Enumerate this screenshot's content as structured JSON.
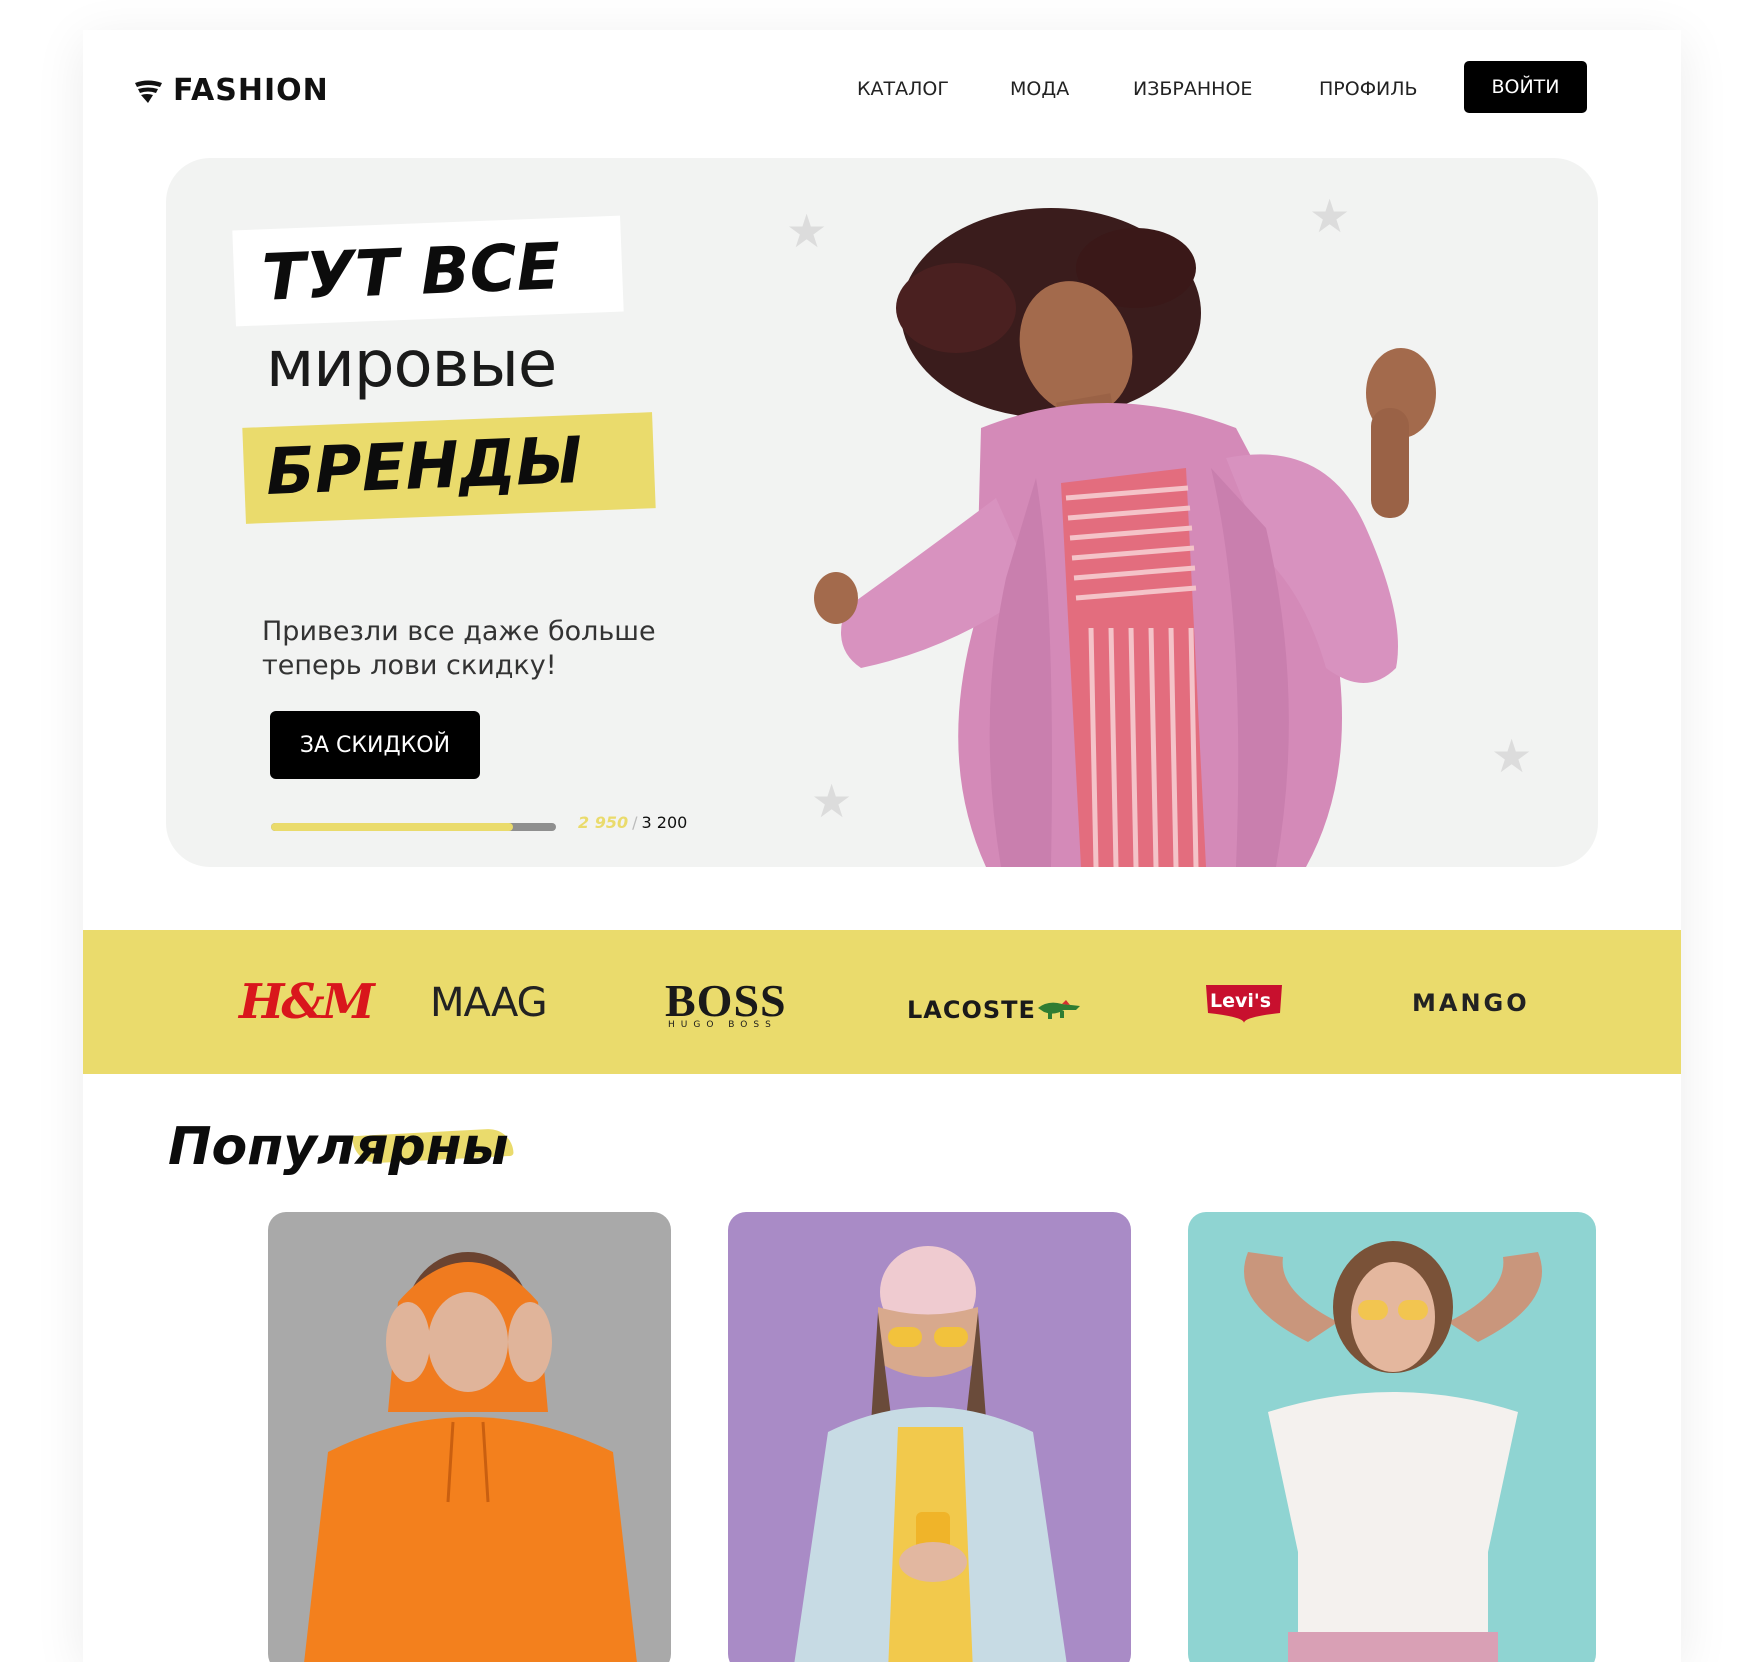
{
  "header": {
    "logo": "FASHION",
    "nav": [
      "КАТАЛОГ",
      "МОДА",
      "ИЗБРАННОЕ",
      "ПРОФИЛЬ"
    ],
    "login_label": "ВОЙТИ"
  },
  "hero": {
    "line1": "ТУТ ВСЕ",
    "line2": "мировые",
    "line3": "БРЕНДЫ",
    "subtitle_line1": "Привезли все даже больше",
    "subtitle_line2": "теперь лови скидку!",
    "cta_label": "ЗА СКИДКОЙ",
    "progress": {
      "current": "2 950",
      "separator": "/",
      "total": "3 200",
      "fraction": 0.85
    }
  },
  "brands": {
    "hm": "H&M",
    "maag": "MAAG",
    "boss": "BOSS",
    "boss_sub": "HUGO BOSS",
    "lacoste": "LACOSTE",
    "levis": "Levi's",
    "mango": "MANGO"
  },
  "popular": {
    "title": "Популярны"
  },
  "colors": {
    "accent_yellow": "#eadb6c",
    "black": "#000000",
    "hero_bg": "#f2f3f2",
    "card1_bg": "#a9a9a9",
    "card2_bg": "#a98bc6",
    "card3_bg": "#8fd4d2"
  },
  "icons": {
    "logo": "wing-logo-icon",
    "stars": "star-icon",
    "lacoste": "crocodile-icon"
  }
}
